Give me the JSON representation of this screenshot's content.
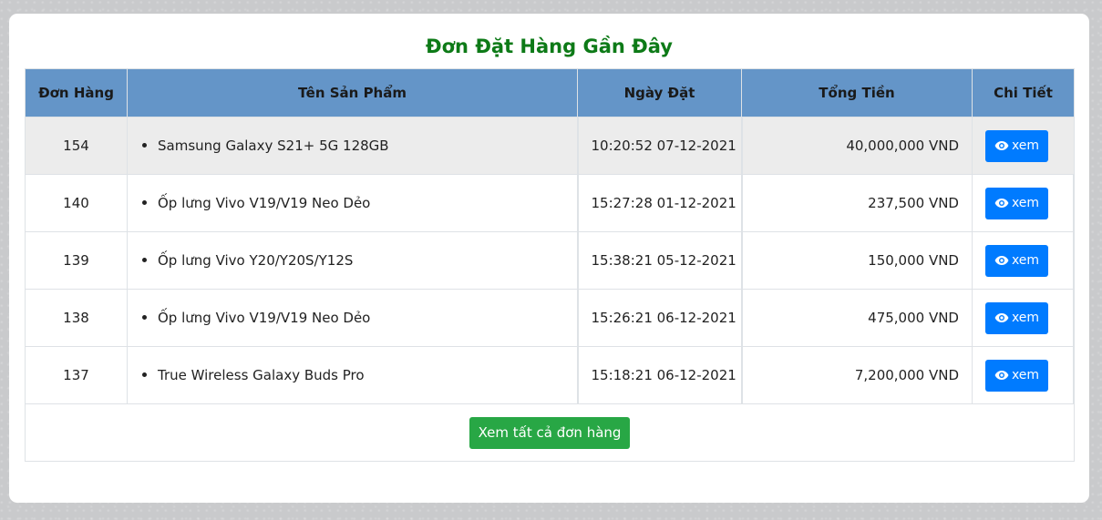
{
  "title": "Đơn Đặt Hàng Gần Đây",
  "colors": {
    "title": "#0d7a17",
    "header_bg": "#6495c8",
    "view_button": "#007bff",
    "all_button": "#28a745"
  },
  "columns": [
    "Đơn Hàng",
    "Tên Sản Phẩm",
    "Ngày Đặt",
    "Tổng Tiền",
    "Chi Tiết"
  ],
  "orders": [
    {
      "id": "154",
      "product": "Samsung Galaxy S21+ 5G 128GB",
      "date": "10:20:52 07-12-2021",
      "total": "40,000,000 VND",
      "action": "xem"
    },
    {
      "id": "140",
      "product": "Ốp lưng Vivo V19/V19 Neo Dẻo",
      "date": "15:27:28 01-12-2021",
      "total": "237,500 VND",
      "action": "xem"
    },
    {
      "id": "139",
      "product": "Ốp lưng Vivo Y20/Y20S/Y12S",
      "date": "15:38:21 05-12-2021",
      "total": "150,000 VND",
      "action": "xem"
    },
    {
      "id": "138",
      "product": "Ốp lưng Vivo V19/V19 Neo Dẻo",
      "date": "15:26:21 06-12-2021",
      "total": "475,000 VND",
      "action": "xem"
    },
    {
      "id": "137",
      "product": "True Wireless Galaxy Buds Pro",
      "date": "15:18:21 06-12-2021",
      "total": "7,200,000 VND",
      "action": "xem"
    }
  ],
  "view_icon": "eye-icon",
  "view_all_label": "Xem tất cả đơn hàng"
}
